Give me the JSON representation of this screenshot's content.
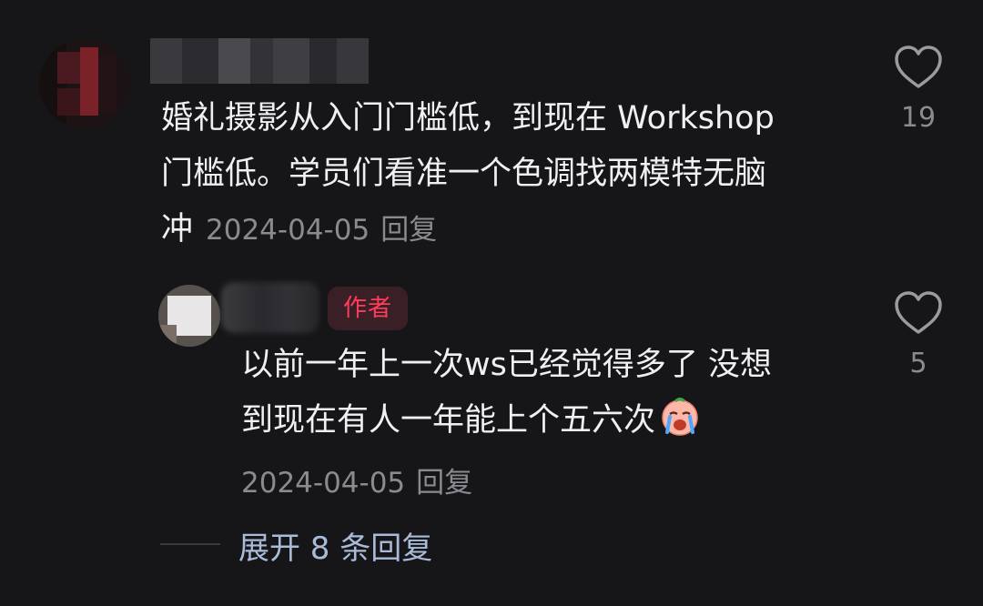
{
  "main_comment": {
    "text_line1": "婚礼摄影从入门门槛低，到现在 Workshop",
    "text_line2": "门槛低。学员们看准一个色调找两模特无脑",
    "text_line3": "冲",
    "date": "2024-04-05",
    "reply_label": "回复",
    "like_count": "19"
  },
  "reply_comment": {
    "author_badge": "作者",
    "text_line1": "以前一年上一次ws已经觉得多了 没想",
    "text_line2": "到现在有人一年能上个五六次",
    "emoji": "crying-face-emoji",
    "date": "2024-04-05",
    "reply_label": "回复",
    "like_count": "5"
  },
  "expand": {
    "label": "展开 8 条回复"
  },
  "colors": {
    "background": "#161619",
    "text": "#f0f0f2",
    "meta": "#8a8a90",
    "badge_text": "#ff3d5a",
    "badge_bg": "#3a1f27",
    "expand_text": "#a9bbd8"
  }
}
